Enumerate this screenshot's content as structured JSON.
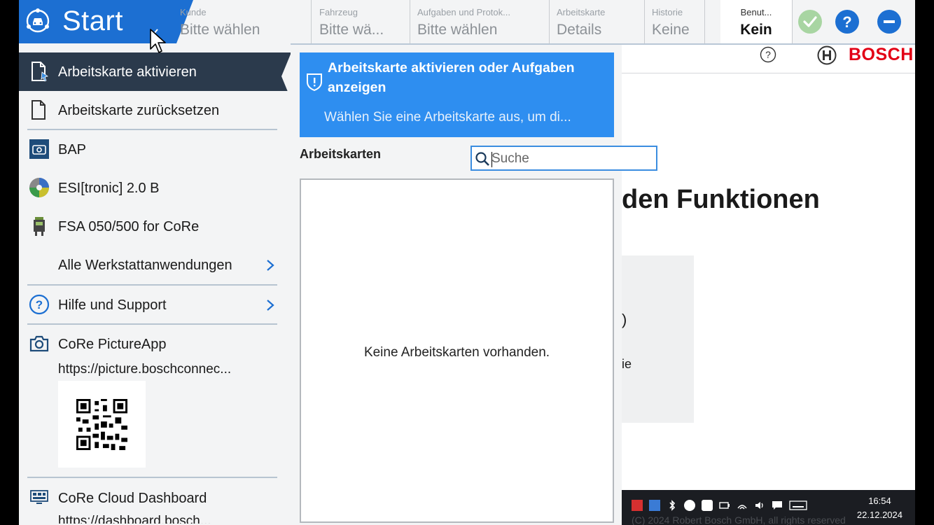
{
  "header": {
    "start_label": "Start",
    "fields": [
      {
        "label": "Kunde",
        "value": "Bitte wählen"
      },
      {
        "label": "Fahrzeug",
        "value": "Bitte wä..."
      },
      {
        "label": "Aufgaben und Protok...",
        "value": "Bitte wählen"
      },
      {
        "label": "Arbeitskarte",
        "value": "Details"
      },
      {
        "label": "Historie",
        "value": "Keine"
      }
    ],
    "user": {
      "label": "Benut...",
      "value": "Kein"
    },
    "icons": [
      "check-icon",
      "help-icon",
      "minimize-icon"
    ],
    "accent_color": "#1c6fd2"
  },
  "menu": {
    "items": [
      {
        "label": "Arbeitskarte aktivieren",
        "icon": "activate-card-icon",
        "active": true
      },
      {
        "label": "Arbeitskarte zurücksetzen",
        "icon": "document-icon"
      },
      {
        "label": "BAP",
        "icon": "bap-app-icon"
      },
      {
        "label": "ESI[tronic] 2.0 B",
        "icon": "esitronic-disc-icon"
      },
      {
        "label": "FSA 050/500 for CoRe",
        "icon": "fsa-device-icon"
      },
      {
        "label": "Alle Werkstattanwendungen",
        "icon": "chevron-right-icon"
      },
      {
        "label": "Hilfe und Support",
        "icon": "help-circle-icon"
      },
      {
        "label": "CoRe PictureApp",
        "icon": "camera-icon"
      },
      {
        "label": "CoRe Cloud Dashboard",
        "icon": "dashboard-icon"
      }
    ],
    "picture_app_url": "https://picture.boschconnec...",
    "cloud_url": "https://dashboard.bosch..."
  },
  "panel": {
    "info_title": "Arbeitskarte aktivieren oder Aufgaben anzeigen",
    "info_text": "Wählen Sie eine Arbeitskarte aus, um di...",
    "section_title": "Arbeitskarten",
    "search_placeholder": "Suche",
    "empty_text": "Keine Arbeitskarten vorhanden.",
    "info_color": "#2e8ef0"
  },
  "background": {
    "brand": "BOSCH",
    "brand_color": "#e20015",
    "heading_fragment": "den Funktionen",
    "card_fragment_1": ")",
    "card_fragment_2": "ie"
  },
  "taskbar": {
    "time": "16:54",
    "date": "22.12.2024",
    "copyright": "(C) 2024 Robert Bosch GmbH, all rights reserved"
  }
}
